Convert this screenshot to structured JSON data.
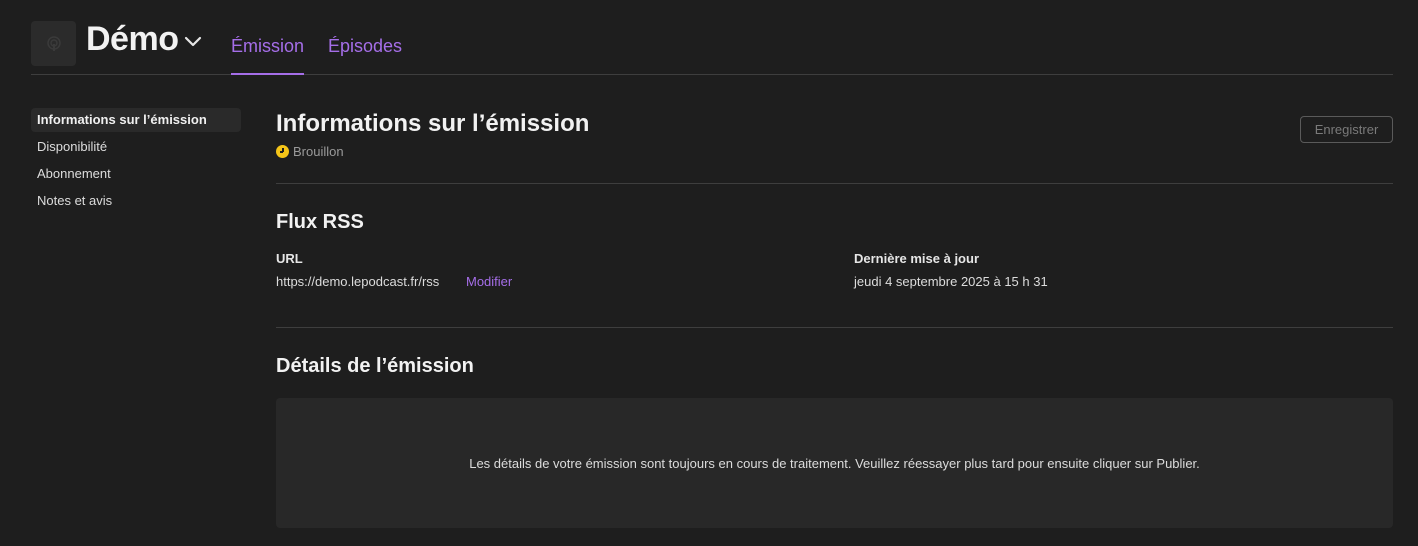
{
  "header": {
    "show_title": "Démo",
    "tabs": [
      {
        "label": "Émission",
        "active": true
      },
      {
        "label": "Épisodes",
        "active": false
      }
    ],
    "accent_color": "#a56ee8"
  },
  "sidebar": {
    "items": [
      {
        "label": "Informations sur l’émission",
        "active": true
      },
      {
        "label": "Disponibilité",
        "active": false
      },
      {
        "label": "Abonnement",
        "active": false
      },
      {
        "label": "Notes et avis",
        "active": false
      }
    ]
  },
  "main": {
    "title": "Informations sur l’émission",
    "status": "Brouillon",
    "status_icon": "clock-icon",
    "status_color": "#f5c518",
    "save_label": "Enregistrer",
    "rss": {
      "title": "Flux RSS",
      "url_label": "URL",
      "url_value": "https://demo.lepodcast.fr/rss",
      "modify_label": "Modifier",
      "updated_label": "Dernière mise à jour",
      "updated_value": "jeudi 4 septembre 2025 à 15 h 31"
    },
    "details": {
      "title": "Détails de l’émission",
      "message": "Les détails de votre émission sont toujours en cours de traitement. Veuillez réessayer plus tard pour ensuite cliquer sur Publier."
    }
  }
}
